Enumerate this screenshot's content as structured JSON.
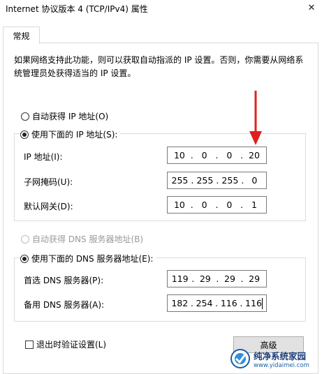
{
  "window": {
    "title": "Internet 协议版本 4 (TCP/IPv4) 属性",
    "close_glyph": "✕"
  },
  "tabs": [
    {
      "label": "常规",
      "selected": true
    }
  ],
  "description": "如果网络支持此功能，则可以获取自动指派的 IP 设置。否则，你需要从网络系统管理员处获得适当的 IP 设置。",
  "ip_section": {
    "auto_label": "自动获得 IP 地址(O)",
    "manual_label": "使用下面的 IP 地址(S):",
    "selected": "manual",
    "fields": [
      {
        "label": "IP 地址(I):",
        "octets": [
          "10",
          "0",
          "0",
          "20"
        ]
      },
      {
        "label": "子网掩码(U):",
        "octets": [
          "255",
          "255",
          "255",
          "0"
        ]
      },
      {
        "label": "默认网关(D):",
        "octets": [
          "10",
          "0",
          "0",
          "1"
        ]
      }
    ]
  },
  "dns_section": {
    "auto_label": "自动获得 DNS 服务器地址(B)",
    "auto_enabled": false,
    "manual_label": "使用下面的 DNS 服务器地址(E):",
    "selected": "manual",
    "fields": [
      {
        "label": "首选 DNS 服务器(P):",
        "octets": [
          "119",
          "29",
          "29",
          "29"
        ]
      },
      {
        "label": "备用 DNS 服务器(A):",
        "octets": [
          "182",
          "254",
          "116",
          "116"
        ]
      }
    ]
  },
  "validate_checkbox": {
    "label": "退出时验证设置(L)",
    "checked": false
  },
  "advanced_button": {
    "label": "高级"
  },
  "annotation": {
    "arrow_color": "#e0201f"
  },
  "watermark": {
    "name": "纯净系统家园",
    "url": "www.yidaimei.com"
  }
}
